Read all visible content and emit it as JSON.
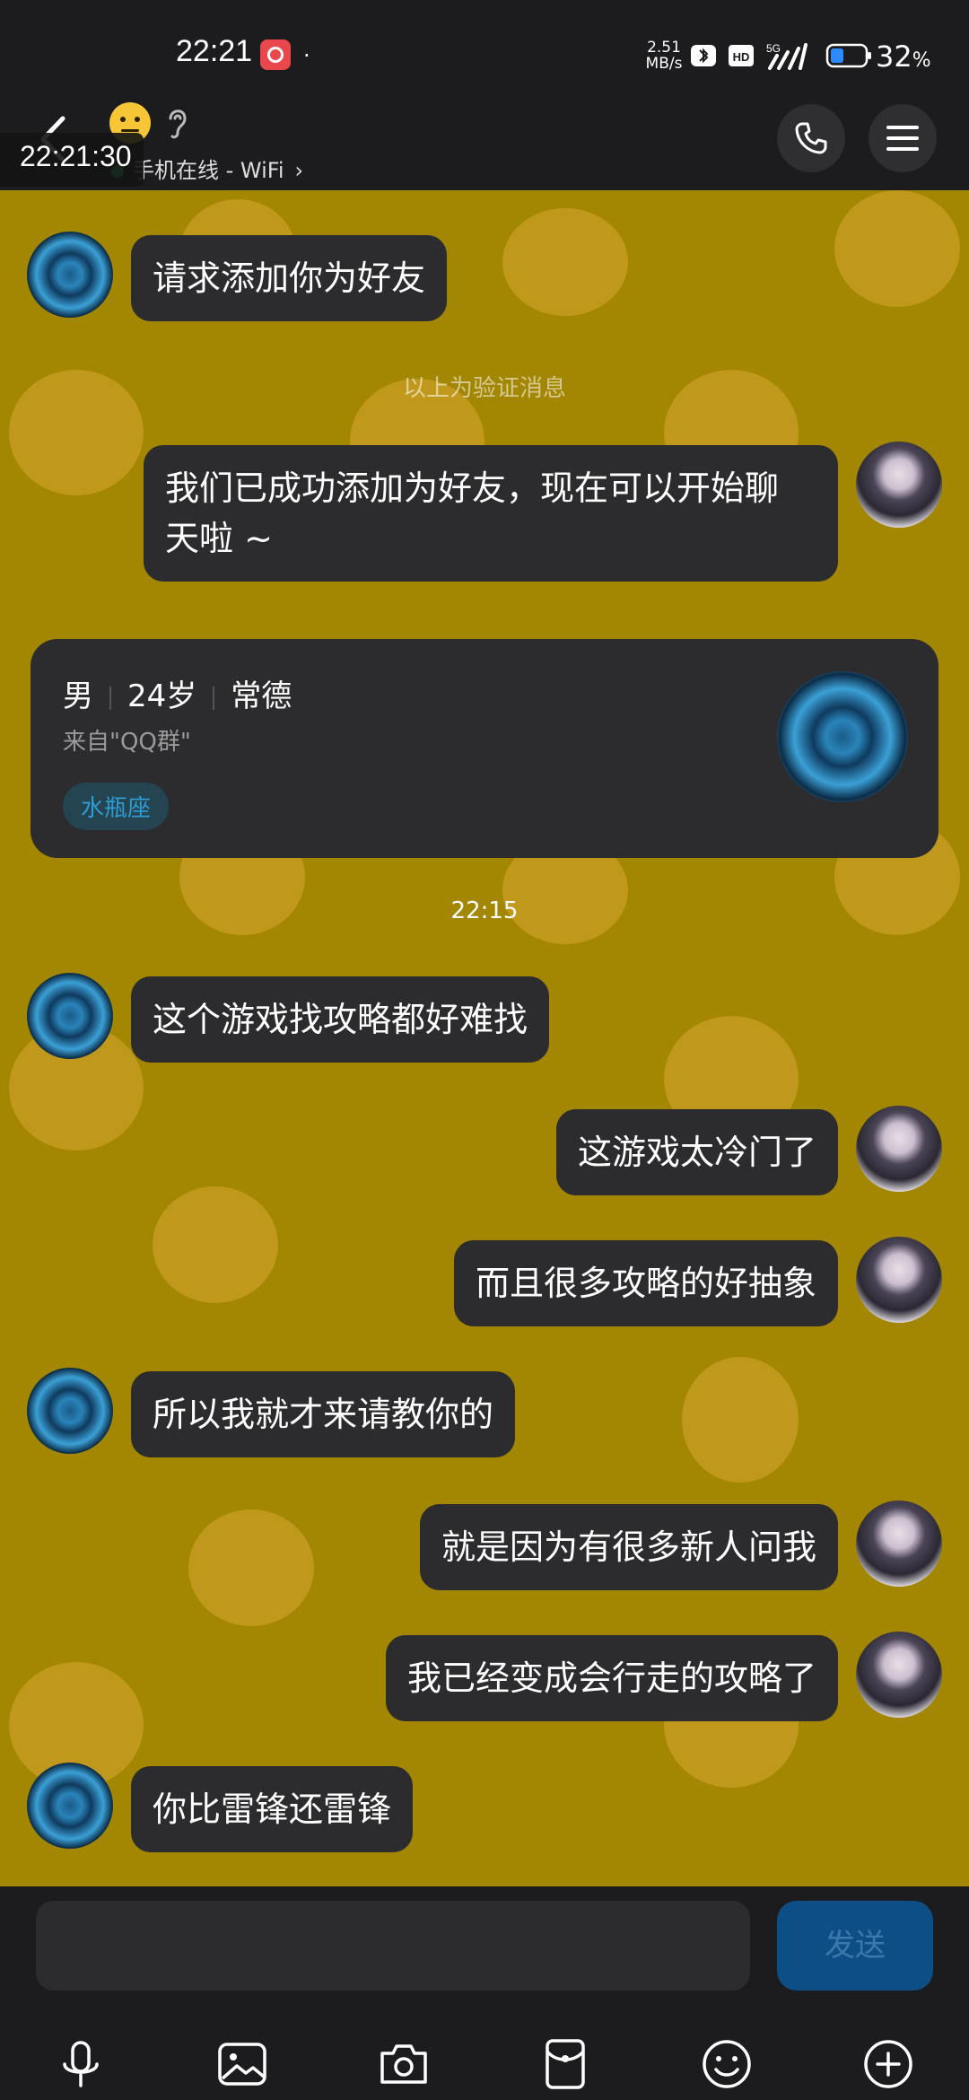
{
  "status_bar": {
    "time": "22:21",
    "dot": "·",
    "net_speed_value": "2.51",
    "net_speed_unit": "MB/s",
    "signal_label": "5G",
    "hd_label": "HD",
    "battery_pct": "32",
    "battery_unit": "%"
  },
  "header": {
    "timestamp_overlay": "22:21:30",
    "online_status": "手机在线 - WiFi",
    "chevron": "›"
  },
  "messages": [
    {
      "side": "left",
      "text": "请求添加你为好友"
    },
    {
      "side": "system",
      "text": "以上为验证消息"
    },
    {
      "side": "right",
      "text_line1": "我们已成功添加为好友，现在可以开始聊",
      "text_line2": "天啦 ~"
    },
    {
      "side": "time",
      "text": "22:15"
    },
    {
      "side": "left",
      "text": "这个游戏找攻略都好难找"
    },
    {
      "side": "right",
      "text": "这游戏太冷门了"
    },
    {
      "side": "right",
      "text": "而且很多攻略的好抽象"
    },
    {
      "side": "left",
      "text": "所以我就才来请教你的"
    },
    {
      "side": "right",
      "text": "就是因为有很多新人问我"
    },
    {
      "side": "right",
      "text": "我已经变成会行走的攻略了"
    },
    {
      "side": "left",
      "text": "你比雷锋还雷锋"
    }
  ],
  "profile_card": {
    "gender": "男",
    "age": "24岁",
    "location": "常德",
    "source": "来自\"QQ群\"",
    "tag": "水瓶座"
  },
  "input_bar": {
    "placeholder": "",
    "send_label": "发送"
  },
  "colors": {
    "chat_background": "#a38602",
    "bubble": "#2c2c2e",
    "send_button": "#0d4e86"
  }
}
